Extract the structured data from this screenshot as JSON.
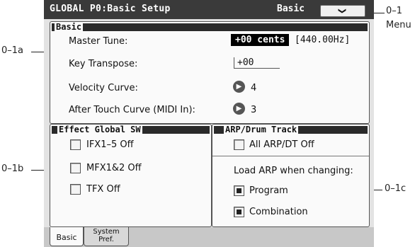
{
  "callouts": {
    "menu_num": "0–1",
    "menu_word": "Menu",
    "basic": "0–1a",
    "effect": "0–1b",
    "arp": "0–1c"
  },
  "titlebar": {
    "title": "GLOBAL P0:Basic Setup",
    "page": "Basic",
    "menu_glyph": "❯"
  },
  "basic": {
    "title": "Basic",
    "master_tune_label": "Master Tune:",
    "master_tune_value": "+00 cents",
    "master_tune_hz": "[440.00Hz]",
    "key_transpose_label": "Key Transpose:",
    "key_transpose_value": "+00",
    "velocity_curve_label": "Velocity Curve:",
    "velocity_curve_value": "4",
    "aftertouch_label": "After Touch Curve (MIDI In):",
    "aftertouch_value": "3"
  },
  "effect": {
    "title": "Effect Global SW",
    "ifx": "IFX1–5 Off",
    "mfx": "MFX1&2 Off",
    "tfx": "TFX Off"
  },
  "arp": {
    "title": "ARP/Drum Track",
    "all_off": "All ARP/DT Off",
    "load_label": "Load ARP when changing:",
    "program": "Program",
    "combination": "Combination"
  },
  "tabs": {
    "basic": "Basic",
    "system_line1": "System",
    "system_line2": "Pref."
  }
}
